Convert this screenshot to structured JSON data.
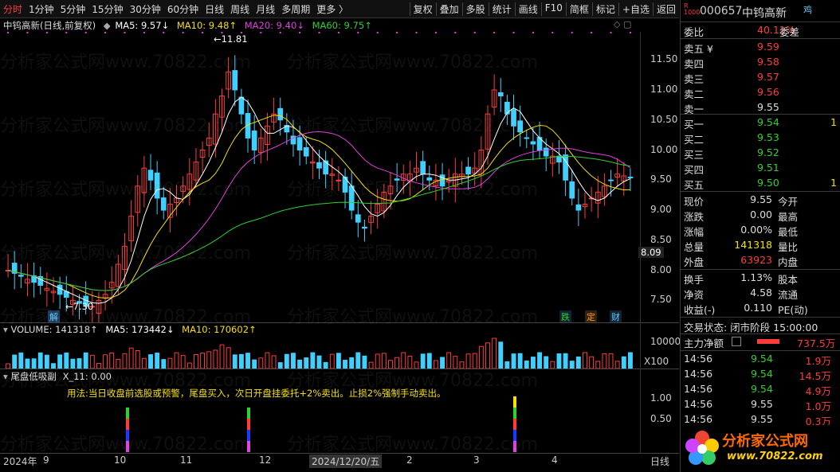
{
  "toolbar": {
    "periods": [
      "分时",
      "1分钟",
      "5分钟",
      "15分钟",
      "30分钟",
      "60分钟",
      "日线",
      "周线",
      "月线",
      "多周期",
      "更多 〉"
    ],
    "tools": [
      "复权",
      "叠加",
      "多股",
      "统计",
      "画线",
      "F10",
      "简框",
      "标记",
      "+自选",
      "返回"
    ]
  },
  "main": {
    "title": "中钨高新(日线,前复权)",
    "ma5": "MA5: 9.57↓",
    "ma10": "MA10: 9.48↑",
    "ma20": "MA20: 9.40↓",
    "ma60": "MA60: 9.75↑",
    "high_label": "11.81",
    "low_label": "7.30",
    "price_tag": "8.09",
    "yticks": [
      "11.50",
      "11.00",
      "10.50",
      "10.00",
      "9.50",
      "9.00",
      "8.50",
      "8.00",
      "7.50"
    ],
    "event_marks": [
      "解",
      "跌",
      "定",
      "财"
    ]
  },
  "volume": {
    "vol": "VOLUME: 141318↑",
    "ma5": "MA5: 173442↓",
    "ma10": "MA10: 170602↑",
    "ytick": "10000",
    "scale": "X100"
  },
  "indicator": {
    "name": "尾盘低吸副",
    "x11": "X_11: 0.00",
    "usage": "用法:当日收盘前选股或预警，尾盘买入，次日开盘挂委托+2%卖出。止损2%强制手动卖出。",
    "yticks": [
      "1.00",
      "0.50"
    ]
  },
  "xaxis": {
    "labels": [
      "2024年",
      "9",
      "10",
      "11",
      "12",
      "2024/12/20/五",
      "2",
      "3",
      "4"
    ],
    "period": "日线"
  },
  "quote": {
    "code": "000657",
    "name": "中钨高新",
    "tag": "R",
    "tag2": "1000",
    "tag3": "鸡",
    "weibi_label": "委比",
    "weibi": "40.11%",
    "weicha_label": "委差",
    "sell": [
      {
        "label": "卖五 ¥",
        "price": "9.59"
      },
      {
        "label": "卖四",
        "price": "9.58"
      },
      {
        "label": "卖三",
        "price": "9.57"
      },
      {
        "label": "卖二",
        "price": "9.56"
      },
      {
        "label": "卖一",
        "price": "9.55"
      }
    ],
    "buy": [
      {
        "label": "买一",
        "price": "9.54",
        "vol": "1"
      },
      {
        "label": "买二",
        "price": "9.53",
        "vol": ""
      },
      {
        "label": "买三",
        "price": "9.52",
        "vol": ""
      },
      {
        "label": "买四",
        "price": "9.51",
        "vol": ""
      },
      {
        "label": "买五",
        "price": "9.50",
        "vol": "1"
      }
    ],
    "stats": [
      {
        "l": "现价",
        "v": "9.55",
        "r": "今开"
      },
      {
        "l": "涨跌",
        "v": "0.00",
        "r": "最高"
      },
      {
        "l": "涨幅",
        "v": "0.00%",
        "r": "最低"
      },
      {
        "l": "总量",
        "v": "141318",
        "r": "量比"
      },
      {
        "l": "外盘",
        "v": "63923",
        "r": "内盘"
      }
    ],
    "stats2": [
      {
        "l": "换手",
        "v": "1.13%",
        "r": "股本"
      },
      {
        "l": "净资",
        "v": "4.58",
        "r": "流通"
      },
      {
        "l": "收益(-)",
        "v": "0.110",
        "r": "PE(动)"
      }
    ],
    "trade_state": "交易状态: 闭市阶段 15:00:00",
    "main_flow_label": "主力净额",
    "main_flow": "737.5万",
    "ticks": [
      {
        "t": "14:56",
        "p": "9.54",
        "v": "1.9万"
      },
      {
        "t": "14:56",
        "p": "9.54",
        "v": "14.5万"
      },
      {
        "t": "14:56",
        "p": "9.54",
        "v": "4.9万"
      },
      {
        "t": "14:56",
        "p": "9.55",
        "v": "1.0万"
      },
      {
        "t": "14:56",
        "p": "9.55",
        "v": "0.3万"
      }
    ],
    "logo_text": "分析家公式网",
    "logo_url": "www.70822.com"
  },
  "watermark": "分析家公式网www.70822.com",
  "chart_data": {
    "type": "line",
    "title": "中钨高新(日线,前复权)",
    "ylim": [
      7.2,
      11.9
    ],
    "series": [
      {
        "name": "MA5",
        "color": "#ffffff"
      },
      {
        "name": "MA10",
        "color": "#f5e000"
      },
      {
        "name": "MA20",
        "color": "#e040e0"
      },
      {
        "name": "MA60",
        "color": "#2fd12f"
      }
    ],
    "close": [
      8.0,
      7.95,
      7.9,
      7.85,
      7.8,
      7.75,
      7.7,
      7.65,
      7.6,
      7.55,
      7.5,
      7.45,
      7.4,
      7.4,
      7.5,
      7.6,
      7.8,
      8.1,
      8.4,
      8.9,
      9.4,
      9.7,
      9.5,
      9.2,
      9.0,
      9.1,
      9.2,
      9.4,
      9.6,
      9.8,
      10.0,
      10.2,
      10.6,
      10.9,
      11.3,
      11.0,
      10.6,
      10.2,
      10.0,
      10.2,
      10.4,
      10.6,
      10.5,
      10.3,
      10.1,
      10.0,
      9.9,
      9.8,
      9.7,
      9.6,
      9.6,
      9.5,
      9.3,
      9.0,
      8.8,
      8.7,
      8.9,
      9.1,
      9.3,
      9.4,
      9.5,
      9.6,
      9.6,
      9.7,
      9.6,
      9.5,
      9.5,
      9.4,
      9.5,
      9.6,
      9.6,
      9.6,
      9.7,
      10.0,
      10.6,
      11.0,
      10.9,
      10.6,
      10.4,
      10.3,
      10.2,
      10.1,
      10.0,
      9.9,
      9.9,
      9.8,
      9.5,
      9.2,
      9.0,
      9.1,
      9.2,
      9.3,
      9.4,
      9.5,
      9.6,
      9.57,
      9.55
    ],
    "volume_ma5": 173442,
    "volume_ma10": 170602,
    "volume": 141318,
    "ma60_last": 9.75,
    "ma20_last": 9.4,
    "ma10_last": 9.48,
    "ma5_last": 9.57
  }
}
